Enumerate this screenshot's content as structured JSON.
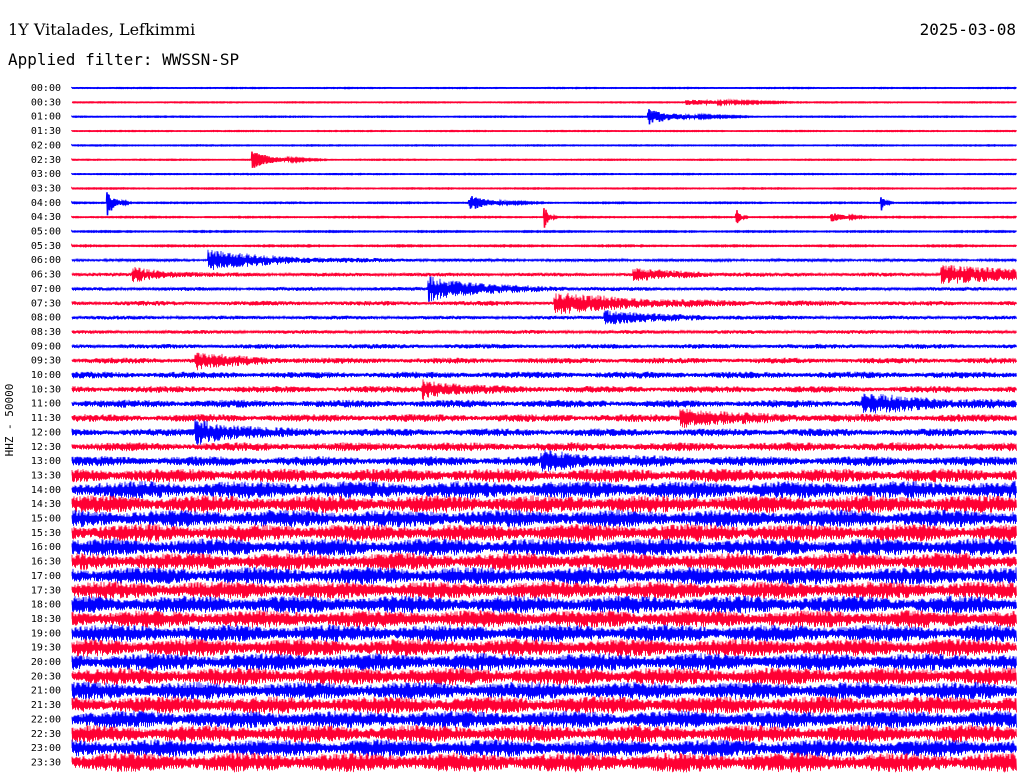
{
  "header": {
    "station": "1Y Vitalades, Lefkimmi",
    "date": "2025-03-08",
    "filter_label": "Applied filter: WWSSN-SP"
  },
  "chart_data": {
    "type": "line",
    "title": "1Y Vitalades, Lefkimmi",
    "date": "2025-03-08",
    "ylabel": "HHZ - 50000",
    "filter": "WWSSN-SP",
    "trace_colors": [
      "#0000ff",
      "#ff0033"
    ],
    "rows": [
      "00:00",
      "00:30",
      "01:00",
      "01:30",
      "02:00",
      "02:30",
      "03:00",
      "03:30",
      "04:00",
      "04:30",
      "05:00",
      "05:30",
      "06:00",
      "06:30",
      "07:00",
      "07:30",
      "08:00",
      "08:30",
      "09:00",
      "09:30",
      "10:00",
      "10:30",
      "11:00",
      "11:30",
      "12:00",
      "12:30",
      "13:00",
      "13:30",
      "14:00",
      "14:30",
      "15:00",
      "15:30",
      "16:00",
      "16:30",
      "17:00",
      "17:30",
      "18:00",
      "18:30",
      "19:00",
      "19:30",
      "20:00",
      "20:30",
      "21:00",
      "21:30",
      "22:00",
      "22:30",
      "23:00",
      "23:30"
    ],
    "noise_level": [
      0.3,
      0.3,
      0.35,
      0.3,
      0.3,
      0.3,
      0.3,
      0.35,
      0.4,
      0.4,
      0.45,
      0.5,
      1.5,
      2.0,
      2.0,
      2.5,
      2.0,
      2.0,
      2.5,
      3.0,
      3.5,
      3.5,
      4.0,
      4.0,
      4.0,
      4.5,
      5.0,
      7.0,
      9.0,
      9.0,
      9.0,
      9.0,
      9.0,
      9.0,
      9.0,
      9.0,
      9.0,
      9.0,
      9.0,
      9.0,
      9.0,
      9.0,
      9.0,
      9.0,
      9.0,
      9.0,
      9.0,
      10.0
    ],
    "events": [
      {
        "row": "00:30",
        "minute": 19.5,
        "amp": 3,
        "dur": 1.2
      },
      {
        "row": "01:00",
        "minute": 18.3,
        "amp": 8,
        "dur": 0.8
      },
      {
        "row": "02:30",
        "minute": 5.7,
        "amp": 9,
        "dur": 0.6
      },
      {
        "row": "04:00",
        "minute": 1.1,
        "amp": 16,
        "dur": 0.2
      },
      {
        "row": "04:00",
        "minute": 12.6,
        "amp": 8,
        "dur": 0.6
      },
      {
        "row": "04:00",
        "minute": 25.7,
        "amp": 10,
        "dur": 0.1
      },
      {
        "row": "04:30",
        "minute": 15.0,
        "amp": 14,
        "dur": 0.1
      },
      {
        "row": "04:30",
        "minute": 21.1,
        "amp": 10,
        "dur": 0.1
      },
      {
        "row": "04:30",
        "minute": 24.1,
        "amp": 5,
        "dur": 0.4
      },
      {
        "row": "06:00",
        "minute": 4.3,
        "amp": 10,
        "dur": 2.0
      },
      {
        "row": "06:30",
        "minute": 1.9,
        "amp": 7,
        "dur": 1.0
      },
      {
        "row": "06:30",
        "minute": 17.8,
        "amp": 6,
        "dur": 1.4
      },
      {
        "row": "06:30",
        "minute": 27.6,
        "amp": 9,
        "dur": 3.0
      },
      {
        "row": "07:00",
        "minute": 11.3,
        "amp": 12,
        "dur": 1.6
      },
      {
        "row": "07:30",
        "minute": 15.3,
        "amp": 10,
        "dur": 2.4
      },
      {
        "row": "08:00",
        "minute": 16.9,
        "amp": 7,
        "dur": 1.6
      },
      {
        "row": "09:30",
        "minute": 3.9,
        "amp": 8,
        "dur": 1.2
      },
      {
        "row": "10:30",
        "minute": 11.1,
        "amp": 9,
        "dur": 1.0
      },
      {
        "row": "11:00",
        "minute": 25.1,
        "amp": 8,
        "dur": 2.0
      },
      {
        "row": "11:30",
        "minute": 19.3,
        "amp": 8,
        "dur": 1.6
      },
      {
        "row": "12:00",
        "minute": 3.9,
        "amp": 12,
        "dur": 1.2
      },
      {
        "row": "13:00",
        "minute": 14.9,
        "amp": 8,
        "dur": 1.6
      }
    ]
  }
}
